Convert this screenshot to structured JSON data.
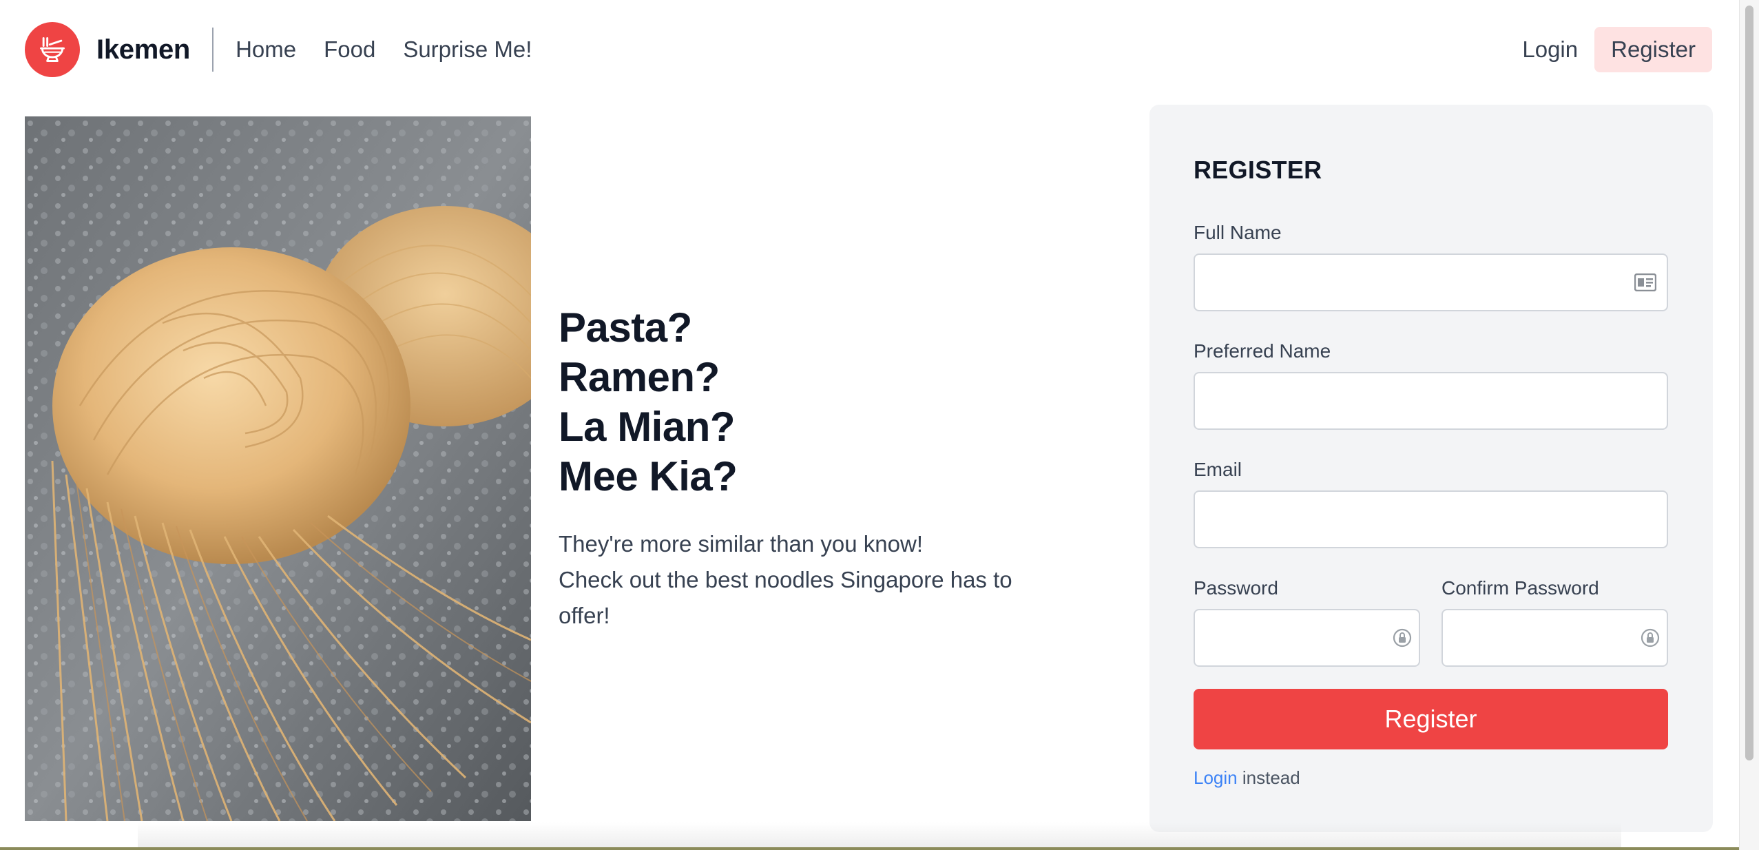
{
  "nav": {
    "brand": "Ikemen",
    "logo_icon": "ramen-bowl-icon",
    "links": [
      {
        "label": "Home"
      },
      {
        "label": "Food"
      },
      {
        "label": "Surprise Me!"
      }
    ],
    "login_label": "Login",
    "register_label": "Register"
  },
  "hero": {
    "image_subject": "fresh-noodle-nests-photo",
    "heading_lines": [
      "Pasta?",
      "Ramen?",
      "La Mian?",
      "Mee Kia?"
    ],
    "sub_lines": [
      "They're more similar than you know!",
      "Check out the best noodles Singapore has to",
      "offer!"
    ]
  },
  "form": {
    "title": "REGISTER",
    "full_name": {
      "label": "Full Name",
      "value": "",
      "icon": "contact-card-icon"
    },
    "preferred_name": {
      "label": "Preferred Name",
      "value": ""
    },
    "email": {
      "label": "Email",
      "value": ""
    },
    "password": {
      "label": "Password",
      "value": "",
      "icon": "password-manager-icon"
    },
    "confirm_password": {
      "label": "Confirm Password",
      "value": "",
      "icon": "password-manager-icon"
    },
    "submit_label": "Register",
    "login_link": "Login",
    "login_suffix": "instead"
  },
  "colors": {
    "accent": "#ef4444",
    "accent_light": "#fee2e2",
    "card_bg": "#f3f4f6",
    "link": "#3b82f6"
  }
}
